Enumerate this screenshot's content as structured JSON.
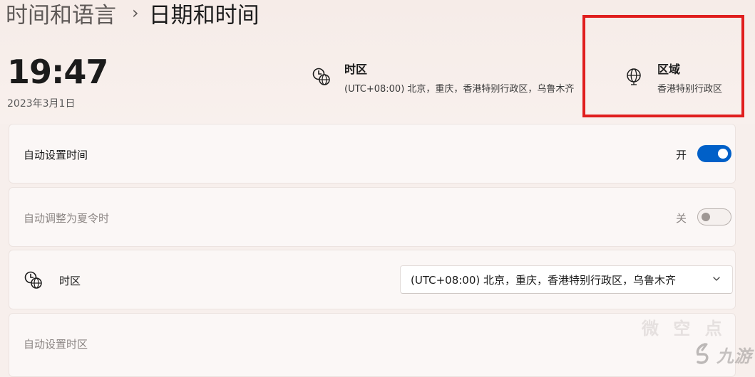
{
  "breadcrumb": {
    "parent": "时间和语言",
    "separator": "›",
    "current": "日期和时间"
  },
  "clock": {
    "time": "19:47",
    "date": "2023年3月1日"
  },
  "header": {
    "timezone": {
      "title": "时区",
      "value": "(UTC+08:00) 北京，重庆，香港特别行政区，乌鲁木齐",
      "icon": "clock-globe-icon"
    },
    "region": {
      "title": "区域",
      "value": "香港特别行政区",
      "icon": "globe-icon"
    }
  },
  "settings": {
    "auto_time": {
      "label": "自动设置时间",
      "state_text": "开",
      "on": true
    },
    "auto_dst": {
      "label": "自动调整为夏令时",
      "state_text": "关",
      "on": false
    },
    "timezone_row": {
      "label": "时区",
      "selected": "(UTC+08:00) 北京，重庆，香港特别行政区，乌鲁木齐",
      "icon": "clock-globe-icon"
    },
    "auto_timezone": {
      "label": "自动设置时区"
    }
  },
  "watermark": {
    "text": "九游",
    "faded": "微 空 点"
  },
  "colors": {
    "accent": "#0060c8",
    "highlight": "#e01e1e",
    "background": "#f7efec"
  }
}
